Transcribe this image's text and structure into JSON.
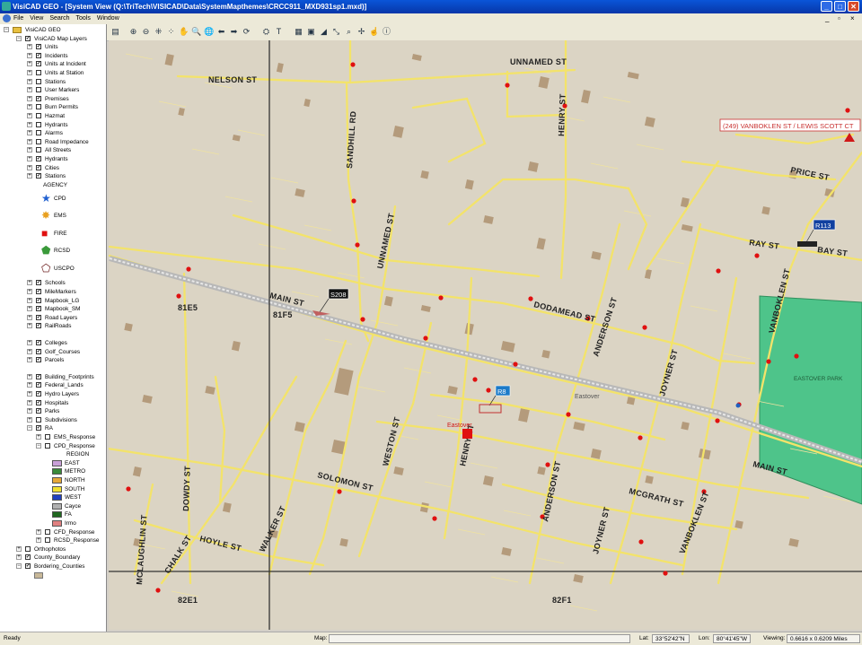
{
  "window": {
    "title": "VisiCAD GEO - [System View (Q:\\TriTech\\VISICAD\\Data\\SystemMapthemes\\CRCC911_MXD931sp1.mxd)]"
  },
  "menu": [
    "File",
    "View",
    "Search",
    "Tools",
    "Window"
  ],
  "tree": {
    "root": "VisiCAD GEO",
    "map_layers": "VisiCAD Map Layers",
    "items": [
      {
        "label": "Units",
        "checked": true
      },
      {
        "label": "Incidents",
        "checked": true
      },
      {
        "label": "Units at Incident",
        "checked": true
      },
      {
        "label": "Units at Station",
        "checked": false
      },
      {
        "label": "Stations",
        "checked": false
      },
      {
        "label": "User Markers",
        "checked": false
      },
      {
        "label": "Premises",
        "checked": true
      },
      {
        "label": "Burn Permits",
        "checked": false
      },
      {
        "label": "Hazmat",
        "checked": false
      },
      {
        "label": "Hydrants",
        "checked": false
      },
      {
        "label": "Alarms",
        "checked": false
      },
      {
        "label": "Road Impedance",
        "checked": false
      },
      {
        "label": "All Streets",
        "checked": false
      },
      {
        "label": "Hydrants",
        "checked": true
      },
      {
        "label": "Cities",
        "checked": true
      },
      {
        "label": "Stations",
        "checked": true
      }
    ],
    "agency_header": "AGENCY",
    "agency_legend": [
      "CPD",
      "EMS",
      "FIRE",
      "RCSD",
      "USCPO"
    ],
    "items2": [
      {
        "label": "Schools",
        "checked": true
      },
      {
        "label": "MileMarkers",
        "checked": true
      },
      {
        "label": "Mapbook_LG",
        "checked": true
      },
      {
        "label": "Mapbook_SM",
        "checked": true
      },
      {
        "label": "Road Layers",
        "checked": true
      },
      {
        "label": "RailRoads",
        "checked": true
      }
    ],
    "items3": [
      {
        "label": "Colleges",
        "checked": true
      },
      {
        "label": "Golf_Courses",
        "checked": true
      },
      {
        "label": "Parcels",
        "checked": true
      }
    ],
    "items4": [
      {
        "label": "Building_Footprints",
        "checked": true
      },
      {
        "label": "Federal_Lands",
        "checked": true
      },
      {
        "label": "Hydro Layers",
        "checked": true
      },
      {
        "label": "Hospitals",
        "checked": true
      },
      {
        "label": "Parks",
        "checked": true
      },
      {
        "label": "Subdivisions",
        "checked": false
      },
      {
        "label": "RA",
        "checked": true
      }
    ],
    "ems_response": "EMS_Response",
    "cpd_response": "CPD_Response",
    "region_header": "REGION",
    "regions": [
      {
        "label": "EAST",
        "color": "#c9a0d8"
      },
      {
        "label": "METRO",
        "color": "#3a8a3a"
      },
      {
        "label": "NORTH",
        "color": "#e6a838"
      },
      {
        "label": "SOUTH",
        "color": "#f0e030"
      },
      {
        "label": "WEST",
        "color": "#2040c0"
      },
      {
        "label": "Cayce",
        "color": "#b0b0b0"
      },
      {
        "label": "FA",
        "color": "#206820"
      },
      {
        "label": "Irmo",
        "color": "#e08080"
      }
    ],
    "cfd_response": "CFD_Response",
    "rcsd_response": "RCSD_Response",
    "bottom": [
      {
        "label": "Orthophotos",
        "checked": false
      },
      {
        "label": "County_Boundary",
        "checked": true
      },
      {
        "label": "Bordering_Counties",
        "checked": true
      }
    ]
  },
  "map": {
    "streets": [
      "NELSON ST",
      "UNNAMED ST",
      "SANDHILL RD",
      "HENRY ST",
      "PRICE ST",
      "RAY ST",
      "BAY ST",
      "UNNAMED ST",
      "MAIN ST",
      "DODAMEAD ST",
      "ANDERSON ST",
      "JOYNER ST",
      "VANBOKLEN ST",
      "DOWDY ST",
      "WESTON ST",
      "HENRY ST",
      "SOLOMON ST",
      "ANDERSON ST",
      "MCGRATH ST",
      "MCLAUGHLIN ST",
      "CHALK ST",
      "HOYLE ST",
      "WALKER ST",
      "JOYNER ST",
      "VANBOKLEN ST",
      "MAIN ST"
    ],
    "grid_labels": [
      "81E5",
      "81F5",
      "82E1",
      "82F1"
    ],
    "incident_label": "(249) VANBOKLEN ST / LEWIS SCOTT CT",
    "unit_labels": [
      "S208",
      "R113",
      "R8"
    ],
    "place_labels": [
      "Eastover",
      "Eastover",
      "EASTOVER PARK"
    ],
    "colors": {
      "background": "#dbd4c4",
      "street": "#f3e36a",
      "rail": "#b8b8b8",
      "park": "#4ec48a",
      "building": "#b49b7c"
    }
  },
  "status": {
    "ready": "Ready",
    "map_label": "Map:",
    "lat_label": "Lat:",
    "lat": "33°52'42\"N",
    "lon_label": "Lon:",
    "lon": "80°41'45\"W",
    "viewing_label": "Viewing:",
    "viewing": "0.6616 x 0.6209 Miles"
  }
}
